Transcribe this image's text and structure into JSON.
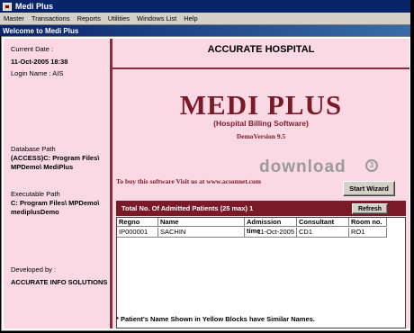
{
  "app": {
    "title": "Medi Plus"
  },
  "menu": [
    "Master",
    "Transactions",
    "Reports",
    "Utilities",
    "Windows List",
    "Help"
  ],
  "child_window": {
    "title": "Welcome to Medi Plus"
  },
  "left_panel": {
    "current_date_label": "Current Date :",
    "current_date_value": "11-Oct-2005 18:38",
    "login_label": "Login Name : AIS",
    "db_path_label": "Database Path",
    "db_path_value": [
      "(ACCESS)C: Program Files\\",
      "MPDemo\\ MediPlus"
    ],
    "exe_path_label": "Executable Path",
    "exe_path_value": [
      "C: Program Files\\ MPDemo\\",
      "mediplusDemo"
    ],
    "developed_label": "Developed by :",
    "developed_value": "ACCURATE INFO SOLUTIONS"
  },
  "right_panel": {
    "hospital": "ACCURATE HOSPITAL",
    "product": "MEDI PLUS",
    "subtitle": "(Hospital Billing Software)",
    "version": "DemoVersion  9.5",
    "watermark": "download",
    "buy_text": "To buy this software Visit us at www.acsonnet.com",
    "start_wizard": "Start Wizard",
    "admitted_text": "Total No. Of Admitted Patients (25 max) 1",
    "refresh": "Refresh",
    "note": "* Patient's Name Shown in Yellow Blocks have Similar Names."
  },
  "table": {
    "headers": [
      "Regno",
      "Name",
      "Admission time",
      "Consultant",
      "Room no."
    ],
    "rows": [
      [
        "IP000001",
        "SACHIN",
        "11-Oct-2005",
        "CD1",
        "RO1"
      ]
    ]
  }
}
